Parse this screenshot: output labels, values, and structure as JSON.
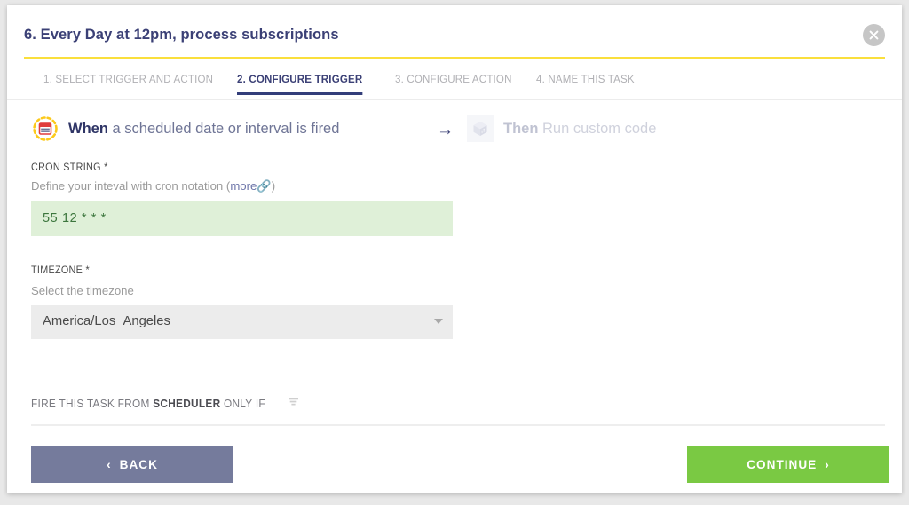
{
  "modal": {
    "title": "6. Every Day at 12pm, process subscriptions",
    "close_icon": "close-icon",
    "accent_color": "#fadf3c"
  },
  "tabs": [
    {
      "label": "1. SELECT TRIGGER AND ACTION",
      "active": false
    },
    {
      "label": "2. CONFIGURE TRIGGER",
      "active": true
    },
    {
      "label": "3. CONFIGURE ACTION",
      "active": false
    },
    {
      "label": "4. NAME THIS TASK",
      "active": false
    }
  ],
  "summary": {
    "trigger": {
      "icon": "calendar-scheduler-icon",
      "keyword": "When",
      "description": "a scheduled date or interval is fired"
    },
    "arrow_icon": "arrow-right-icon",
    "action": {
      "icon": "cube-code-icon",
      "keyword": "Then",
      "description": "Run custom code"
    }
  },
  "form": {
    "cron": {
      "label": "CRON STRING *",
      "hint_prefix": "Define your inteval with cron notation (",
      "hint_link": "more",
      "hint_suffix": ")",
      "link_icon": "external-link-icon",
      "value": "55 12 * * *",
      "placeholder": "* * * * *",
      "valid_bg": "#dff0d8",
      "valid_text": "#3c763d"
    },
    "timezone": {
      "label": "TIMEZONE *",
      "hint": "Select the timezone",
      "value": "America/Los_Angeles",
      "caret_icon": "chevron-down-icon"
    }
  },
  "conditions": {
    "prefix": "FIRE THIS TASK FROM ",
    "source": "SCHEDULER",
    "suffix": " ONLY IF",
    "filter_icon": "filter-funnel-icon"
  },
  "footer": {
    "back": {
      "label": "BACK",
      "chevron": "‹",
      "color": "#757b9c"
    },
    "continue": {
      "label": "CONTINUE",
      "chevron": "›",
      "color": "#7ac943"
    }
  }
}
